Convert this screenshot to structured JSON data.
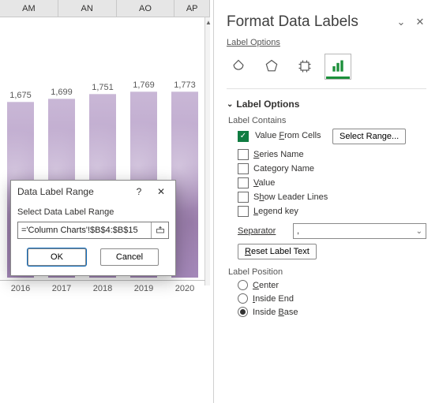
{
  "columns": [
    "AM",
    "AN",
    "AO",
    "AP"
  ],
  "chart_data": {
    "type": "bar",
    "categories": [
      "2016",
      "2017",
      "2018",
      "2019",
      "2020"
    ],
    "values": [
      1675,
      1699,
      1751,
      1769,
      1773
    ],
    "title": "",
    "xlabel": "",
    "ylabel": "",
    "ylim": [
      0,
      1800
    ]
  },
  "dialog": {
    "title": "Data Label Range",
    "prompt": "Select Data Label Range",
    "ref_value": "='Column Charts'!$B$4:$B$15",
    "ok": "OK",
    "cancel": "Cancel",
    "help_tooltip": "?"
  },
  "pane": {
    "title": "Format Data Labels",
    "subtitle": "Label Options",
    "section_label_options": "Label Options",
    "label_contains": "Label Contains",
    "value_from_cells": "Value From Cells",
    "select_range_btn": "Select Range...",
    "series_name": "Series Name",
    "category_name": "Category Name",
    "value": "Value",
    "show_leader": "Show Leader Lines",
    "legend_key": "Legend key",
    "separator_label": "Separator",
    "separator_value": ",",
    "reset_label_text": "Reset Label Text",
    "label_position": "Label Position",
    "pos_center": "Center",
    "pos_inside_end": "Inside End",
    "pos_inside_base": "Inside Base"
  }
}
